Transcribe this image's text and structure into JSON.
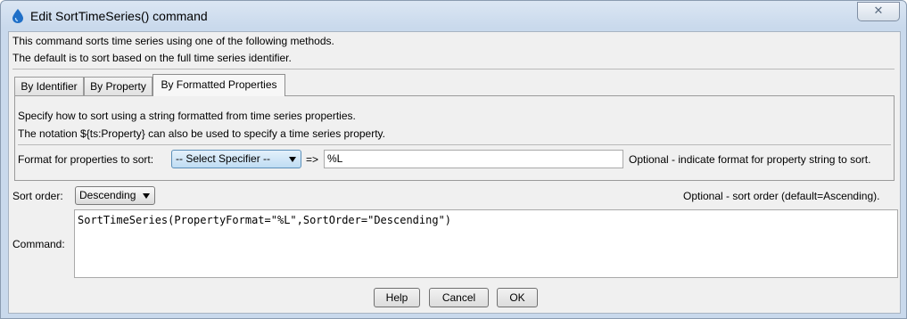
{
  "window": {
    "title": "Edit SortTimeSeries() command",
    "close_glyph": "✕"
  },
  "description": {
    "line1": "This command sorts time series using one of the following methods.",
    "line2": "The default is to sort based on the full time series identifier."
  },
  "tabs": [
    {
      "label": "By Identifier",
      "active": false
    },
    {
      "label": "By Property",
      "active": false
    },
    {
      "label": "By Formatted Properties",
      "active": true
    }
  ],
  "formatted_panel": {
    "line1": "Specify how to sort using a string formatted from time series properties.",
    "line2": "The notation ${ts:Property} can also be used to specify a time series property.",
    "format_label": "Format for properties to sort:",
    "specifier_select": "-- Select Specifier --",
    "arrow_text": "=>",
    "format_value": "%L",
    "format_hint": "Optional - indicate format for property string to sort."
  },
  "sort_order": {
    "label": "Sort order:",
    "value": "Descending",
    "hint": "Optional - sort order (default=Ascending)."
  },
  "command": {
    "label": "Command:",
    "text": "SortTimeSeries(PropertyFormat=\"%L\",SortOrder=\"Descending\")"
  },
  "buttons": {
    "help": "Help",
    "cancel": "Cancel",
    "ok": "OK"
  },
  "colors": {
    "titlebar": "#c9d9ec",
    "client_bg": "#f0f0f0",
    "select_highlight": "#bfdcf3"
  },
  "icons": {
    "app": "water-drop-icon",
    "close": "close-icon",
    "dropdown": "chevron-down-icon"
  }
}
